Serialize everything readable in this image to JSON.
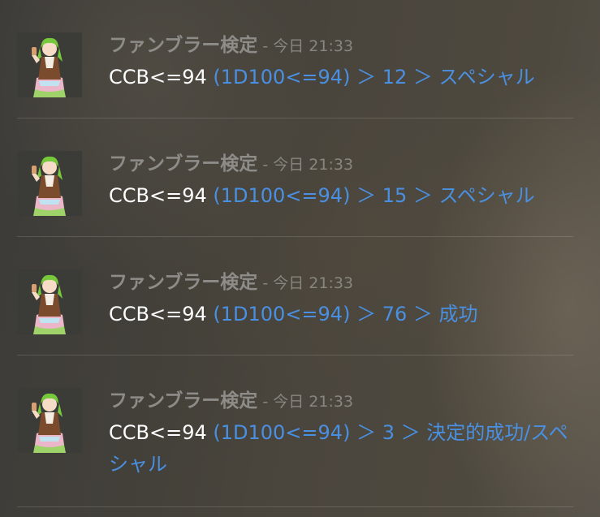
{
  "messages": [
    {
      "username": "ファンブラー検定",
      "separator": " - ",
      "timestamp": "今日 21:33",
      "command": "CCB<=94",
      "result": "(1D100<=94) ＞ 12 ＞ スペシャル"
    },
    {
      "username": "ファンブラー検定",
      "separator": " - ",
      "timestamp": "今日 21:33",
      "command": "CCB<=94",
      "result": "(1D100<=94) ＞ 15 ＞ スペシャル"
    },
    {
      "username": "ファンブラー検定",
      "separator": " - ",
      "timestamp": "今日 21:33",
      "command": "CCB<=94",
      "result": "(1D100<=94) ＞ 76 ＞ 成功"
    },
    {
      "username": "ファンブラー検定",
      "separator": " - ",
      "timestamp": "今日 21:33",
      "command": "CCB<=94",
      "result": "(1D100<=94) ＞ 3 ＞ 決定的成功/スペシャル"
    }
  ],
  "colors": {
    "username": "#8d8c89",
    "timestamp": "#87867f",
    "command": "#ffffff",
    "result": "#4a90e2"
  },
  "icons": {
    "avatar": "character-avatar-icon"
  }
}
